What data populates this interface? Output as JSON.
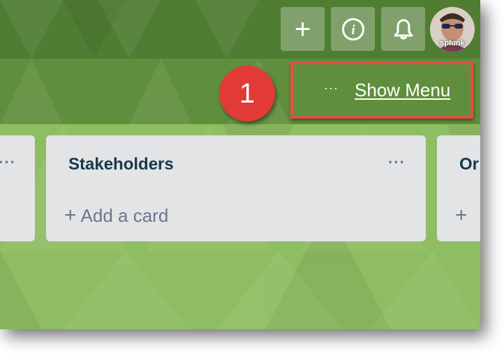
{
  "header": {
    "add_button_glyph": "+",
    "info_button_glyph": "i",
    "notifications_icon": "bell-icon",
    "avatar_label": "splunk"
  },
  "board_header": {
    "menu_dots": "···",
    "show_menu_label": "Show Menu"
  },
  "annotation": {
    "step_number": "1",
    "color": "#e23b37"
  },
  "lists": [
    {
      "title": "",
      "menu": "···"
    },
    {
      "title": "Stakeholders",
      "menu": "···",
      "add_card_label": "Add a card",
      "add_card_plus": "+"
    },
    {
      "title": "Or",
      "add_card_plus": "+"
    }
  ],
  "colors": {
    "board_green": "#8cbb5e",
    "list_bg": "#e2e4e6",
    "list_title": "#17394d"
  }
}
